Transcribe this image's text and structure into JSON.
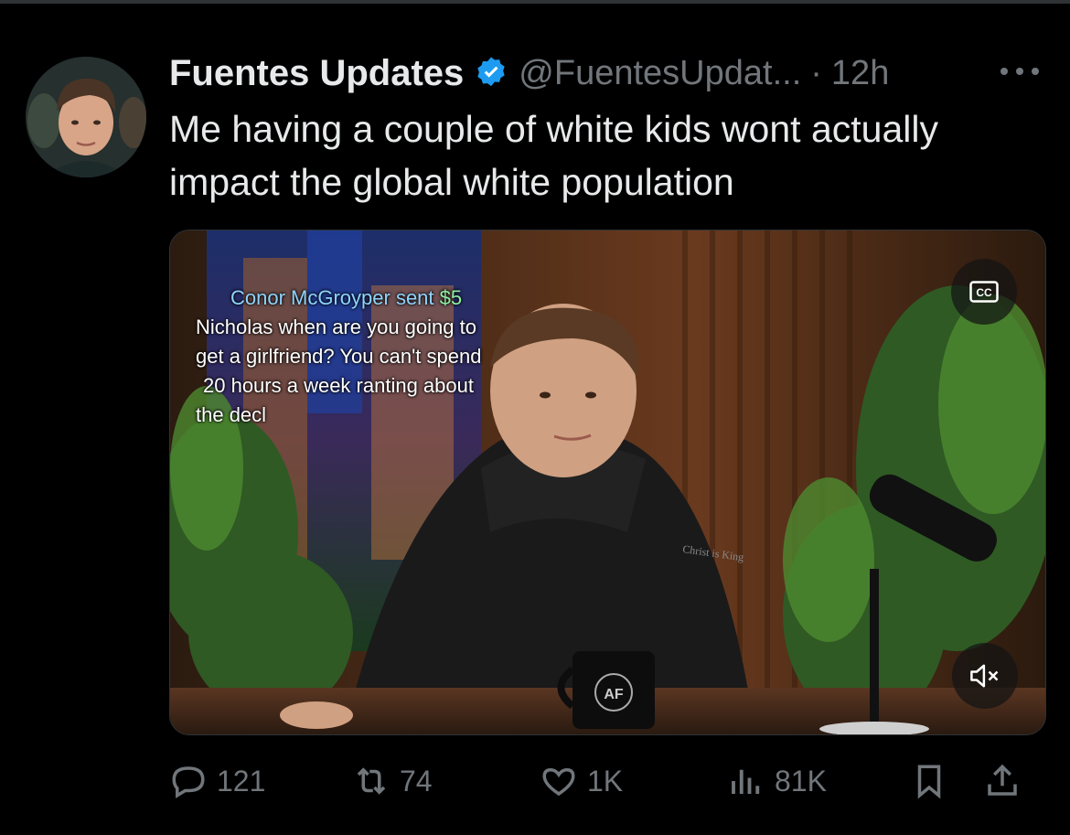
{
  "tweet": {
    "author_name": "Fuentes Updates",
    "handle": "@FuentesUpdat...",
    "separator": "·",
    "time": "12h",
    "more_icon": "more-dots-icon",
    "verified_icon": "verified-badge-icon",
    "text": "Me having a couple of white kids wont actually impact the global white population"
  },
  "media": {
    "caption_sender": "Conor McGroyper sent ",
    "caption_amount": "$5",
    "caption_lines": [
      "Nicholas when are you going to",
      "get a girlfriend? You can't spend",
      "20 hours a week ranting about",
      "the decl"
    ],
    "hoodie_text": "Christ is King",
    "mug_text": "AF",
    "cc_icon": "cc-icon",
    "mute_icon": "volume-muted-icon"
  },
  "actions": {
    "replies": "121",
    "reposts": "74",
    "likes": "1K",
    "views": "81K",
    "bookmark_icon": "bookmark-icon",
    "share_icon": "share-icon"
  },
  "colors": {
    "background": "#000000",
    "text_primary": "#e7e9ea",
    "text_secondary": "#71767b",
    "verified_blue": "#1d9bf0"
  }
}
